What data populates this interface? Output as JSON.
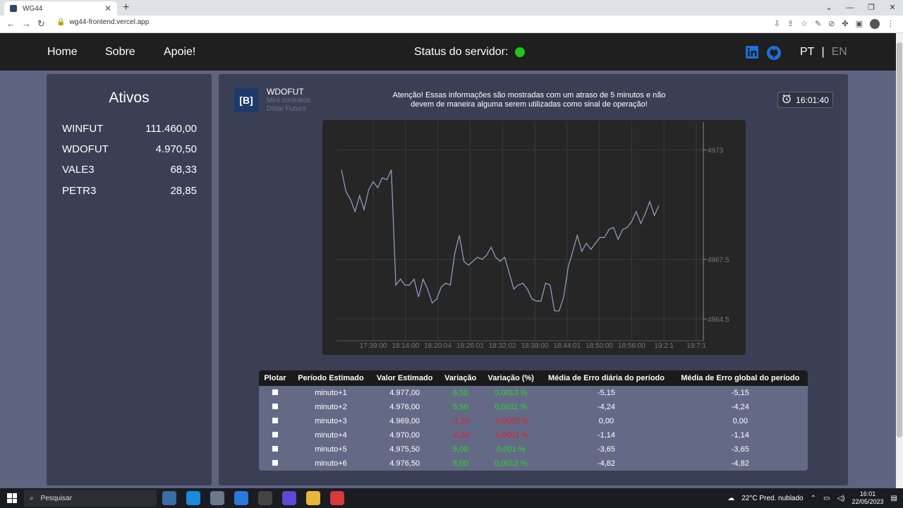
{
  "browser": {
    "tab_title": "WG44",
    "url": "wg44-frontend.vercel.app"
  },
  "header": {
    "nav": [
      "Home",
      "Sobre",
      "Apoie!"
    ],
    "status_label": "Status do servidor:",
    "status_color": "#1ec71e",
    "lang_active": "PT",
    "lang_sep": "|",
    "lang_inactive": "EN"
  },
  "sidebar": {
    "title": "Ativos",
    "assets": [
      {
        "name": "WINFUT",
        "value": "111.460,00"
      },
      {
        "name": "WDOFUT",
        "value": "4.970,50"
      },
      {
        "name": "VALE3",
        "value": "68,33"
      },
      {
        "name": "PETR3",
        "value": "28,85"
      }
    ]
  },
  "main": {
    "logo_text": "[B]",
    "asset_name": "WDOFUT",
    "asset_sub1": "Mini contratos",
    "asset_sub2": "Dólar Futuro",
    "warning_line1": "Atenção! Essas informações são mostradas com um atraso de 5 minutos e não",
    "warning_line2": "devem de maneira alguma serem utilizadas como sinal de operação!",
    "time": "16:01:40"
  },
  "chart_data": {
    "type": "line",
    "x_tick_labels": [
      "17:39:00",
      "18:14:00",
      "18:20:04",
      "18:26:01",
      "18:32:02",
      "18:38:00",
      "18:44:01",
      "18:50:00",
      "18:56:00",
      "19:2:1",
      "19:7:1"
    ],
    "y_ticks": [
      4973,
      4967.5,
      4964.5
    ],
    "y_tick_labels": [
      "4973",
      "4967.5",
      "4964.5"
    ],
    "ylim": [
      4963.4,
      4974.4
    ],
    "grid": true,
    "line_color": "#9aa0c8",
    "values": [
      4972.0,
      4970.9,
      4970.5,
      4969.9,
      4970.7,
      4970.0,
      4971.0,
      4971.4,
      4971.1,
      4971.6,
      4971.5,
      4972.0,
      4966.2,
      4966.5,
      4966.2,
      4966.2,
      4966.5,
      4965.6,
      4966.5,
      4966.0,
      4965.3,
      4965.5,
      4966.1,
      4966.3,
      4966.2,
      4967.8,
      4968.7,
      4967.4,
      4967.2,
      4967.4,
      4967.6,
      4967.5,
      4967.7,
      4968.1,
      4967.6,
      4967.4,
      4967.6,
      4966.8,
      4966.0,
      4966.2,
      4966.3,
      4966.0,
      4965.5,
      4965.4,
      4965.4,
      4966.3,
      4966.2,
      4964.9,
      4964.9,
      4965.6,
      4967.1,
      4967.9,
      4968.7,
      4967.9,
      4968.3,
      4968.0,
      4968.3,
      4968.6,
      4968.6,
      4969.0,
      4969.1,
      4968.5,
      4969.0,
      4969.1,
      4969.4,
      4969.9,
      4969.3,
      4969.8,
      4970.4,
      4969.7,
      4970.2
    ]
  },
  "table": {
    "headers": [
      "Plotar",
      "Período Estimado",
      "Valor Estimado",
      "Variação",
      "Variação (%)",
      "Média de Erro diária do período",
      "Média de Erro global do período"
    ],
    "rows": [
      {
        "periodo": "minuto+1",
        "valor": "4.977,00",
        "var": "6,50",
        "var_pct": "0,0013 %",
        "sign": "pos",
        "err_d": "-5,15",
        "err_g": "-5,15"
      },
      {
        "periodo": "minuto+2",
        "valor": "4.976,00",
        "var": "5,50",
        "var_pct": "0,0011 %",
        "sign": "pos",
        "err_d": "-4,24",
        "err_g": "-4,24"
      },
      {
        "periodo": "minuto+3",
        "valor": "4.969,00",
        "var": "-1,50",
        "var_pct": "-0,0003 %",
        "sign": "neg",
        "err_d": "0,00",
        "err_g": "0,00"
      },
      {
        "periodo": "minuto+4",
        "valor": "4.970,00",
        "var": "-0,50",
        "var_pct": "-0,0001 %",
        "sign": "neg",
        "err_d": "-1,14",
        "err_g": "-1,14"
      },
      {
        "periodo": "minuto+5",
        "valor": "4.975,50",
        "var": "5,00",
        "var_pct": "0,001 %",
        "sign": "pos",
        "err_d": "-3,65",
        "err_g": "-3,65"
      },
      {
        "periodo": "minuto+6",
        "valor": "4.976,50",
        "var": "6,00",
        "var_pct": "0,0012 %",
        "sign": "pos",
        "err_d": "-4,82",
        "err_g": "-4,82"
      }
    ]
  },
  "taskbar": {
    "search_placeholder": "Pesquisar",
    "weather": "22°C  Pred. nublado",
    "time": "16:01",
    "date": "22/05/2023"
  }
}
